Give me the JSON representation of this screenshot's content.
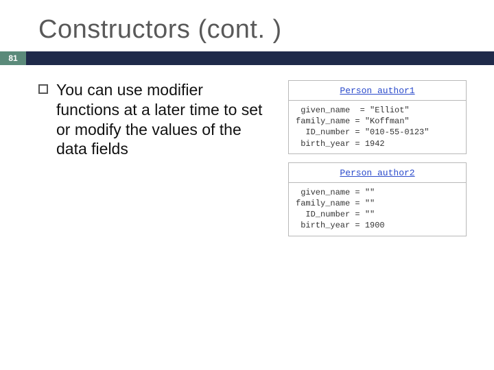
{
  "title": "Constructors (cont. )",
  "page_number": "81",
  "bullet": "You can use modifier functions at a later time to set or modify the values of the data fields",
  "objects": [
    {
      "header": "Person author1",
      "fields": " given_name  = \"Elliot\"\nfamily_name = \"Koffman\"\n  ID_number = \"010-55-0123\"\n birth_year = 1942"
    },
    {
      "header": "Person author2",
      "fields": " given_name = \"\"\nfamily_name = \"\"\n  ID_number = \"\"\n birth_year = 1900"
    }
  ],
  "colors": {
    "title_text": "#595959",
    "bar": "#1f2a4a",
    "badge": "#5b8a7a",
    "object_header_text": "#2a4acb"
  }
}
